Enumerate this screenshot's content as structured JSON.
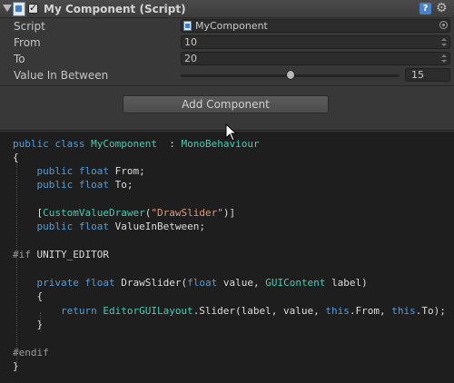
{
  "component": {
    "title": "My Component (Script)",
    "help_icon": "help-icon",
    "gear_icon": "gear-icon"
  },
  "fields": {
    "script": {
      "label": "Script",
      "value": "MyComponent"
    },
    "from": {
      "label": "From",
      "value": "10"
    },
    "to": {
      "label": "To",
      "value": "20"
    },
    "value_in_between": {
      "label": "Value In Between",
      "value": "15",
      "slider_fraction": 0.5
    }
  },
  "add_component": {
    "label": "Add Component"
  },
  "code": [
    [
      [
        "kw",
        "public "
      ],
      [
        "kw",
        "class "
      ],
      [
        "ty",
        "MyComponent"
      ],
      [
        "",
        "  : "
      ],
      [
        "ty",
        "MonoBehaviour"
      ]
    ],
    [
      [
        "",
        "{"
      ]
    ],
    [
      [
        "",
        "    "
      ],
      [
        "kw",
        "public "
      ],
      [
        "kw",
        "float "
      ],
      [
        "",
        "From;"
      ]
    ],
    [
      [
        "",
        "    "
      ],
      [
        "kw",
        "public "
      ],
      [
        "kw",
        "float "
      ],
      [
        "",
        "To;"
      ]
    ],
    [
      [
        "",
        ""
      ]
    ],
    [
      [
        "",
        "    ["
      ],
      [
        "ty",
        "CustomValueDrawer"
      ],
      [
        "",
        "("
      ],
      [
        "st",
        "\"DrawSlider\""
      ],
      [
        "",
        ")]"
      ]
    ],
    [
      [
        "",
        "    "
      ],
      [
        "kw",
        "public "
      ],
      [
        "kw",
        "float "
      ],
      [
        "",
        "ValueInBetween;"
      ]
    ],
    [
      [
        "",
        ""
      ]
    ],
    [
      [
        "pp",
        "#if "
      ],
      [
        "",
        "UNITY_EDITOR"
      ]
    ],
    [
      [
        "",
        ""
      ]
    ],
    [
      [
        "",
        "    "
      ],
      [
        "kw",
        "private "
      ],
      [
        "kw",
        "float "
      ],
      [
        "",
        "DrawSlider("
      ],
      [
        "kw",
        "float "
      ],
      [
        "",
        "value, "
      ],
      [
        "ty",
        "GUIContent "
      ],
      [
        "",
        "label)"
      ]
    ],
    [
      [
        "",
        "    {"
      ]
    ],
    [
      [
        "",
        "        "
      ],
      [
        "kw",
        "return "
      ],
      [
        "ty",
        "EditorGUILayout"
      ],
      [
        "",
        ".Slider(label, value, "
      ],
      [
        "kw",
        "this"
      ],
      [
        "",
        ".From, "
      ],
      [
        "kw",
        "this"
      ],
      [
        "",
        ".To);"
      ]
    ],
    [
      [
        "",
        "    }"
      ]
    ],
    [
      [
        "",
        ""
      ]
    ],
    [
      [
        "pp",
        "#endif"
      ]
    ],
    [
      [
        "",
        "}"
      ]
    ]
  ],
  "colors": {
    "keyword": "#569cd6",
    "type": "#4ec9b0",
    "string": "#d69d85",
    "preprocessor": "#9b9b9b"
  }
}
